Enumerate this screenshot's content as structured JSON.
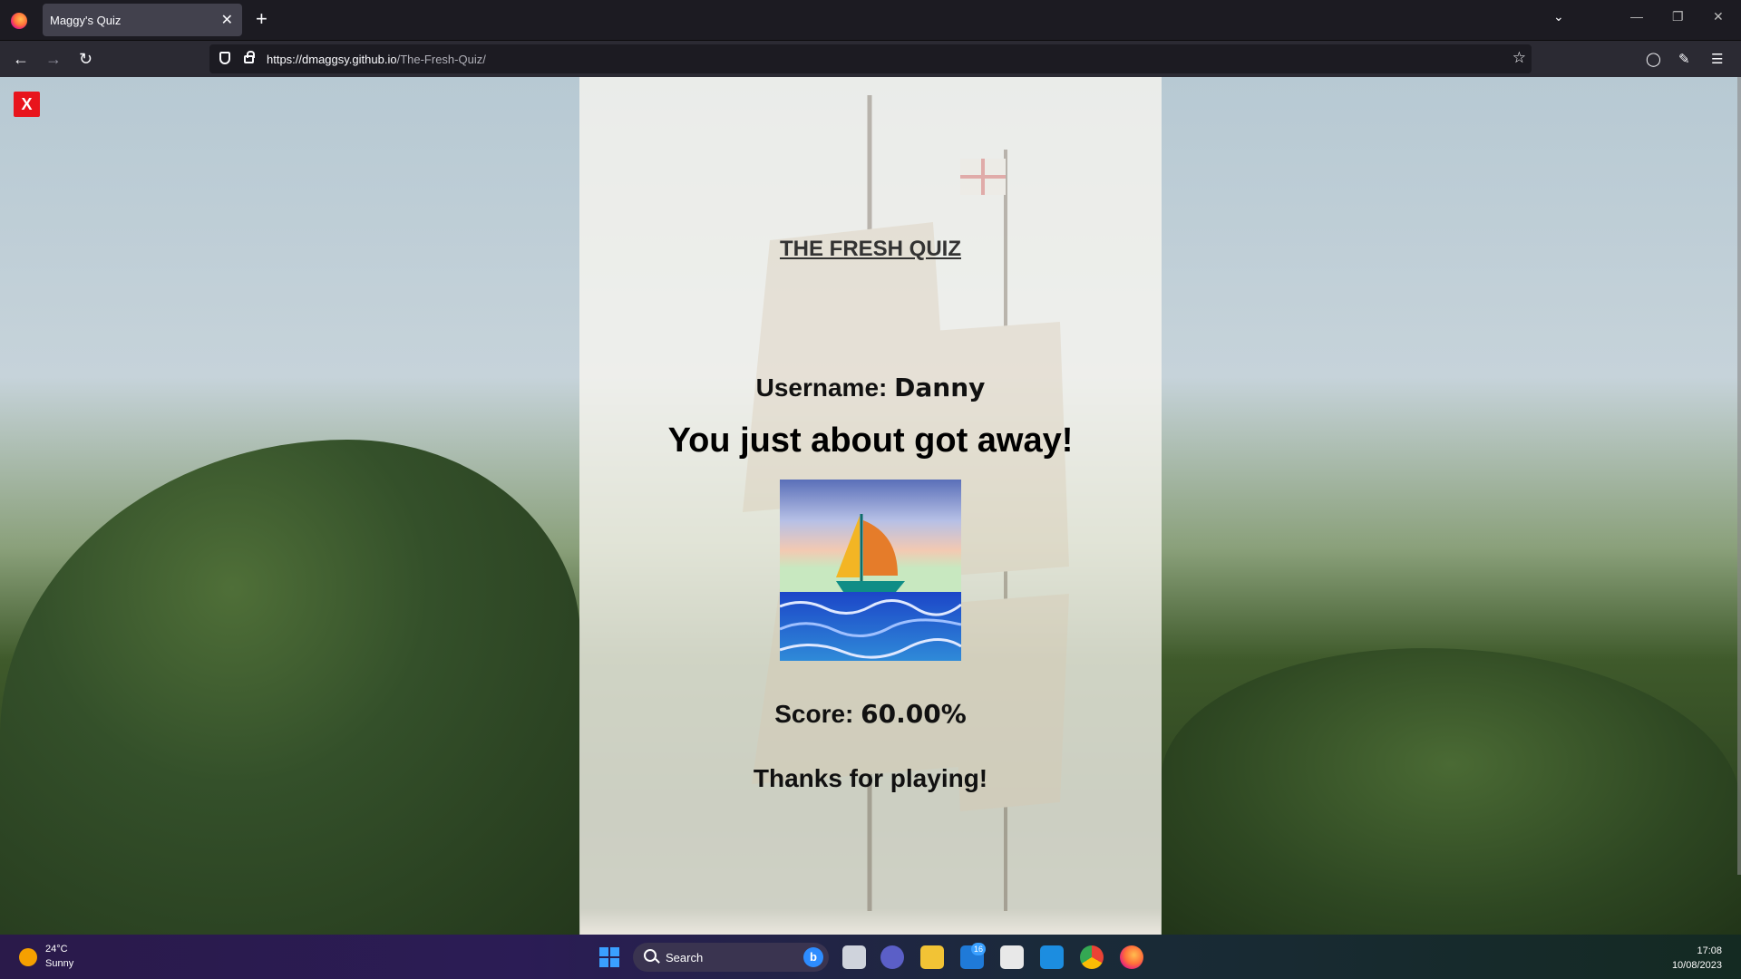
{
  "browser": {
    "tab_title": "Maggy's Quiz",
    "tab_close": "✕",
    "new_tab": "+",
    "url_host": "https://dmaggsy.github.io",
    "url_path": "/The-Fresh-Quiz/"
  },
  "page": {
    "close_label": "X",
    "quiz_title": "THE FRESH QUIZ",
    "username_label": "Username:",
    "username_value": "Danny",
    "result_message": "You just about got away!",
    "score_label": "Score:",
    "score_value": "60.00%",
    "thanks": "Thanks for playing!"
  },
  "taskbar": {
    "temperature": "24°C",
    "condition": "Sunny",
    "search_label": "Search",
    "mail_badge": "16",
    "time": "17:08",
    "date": "10/08/2023"
  }
}
